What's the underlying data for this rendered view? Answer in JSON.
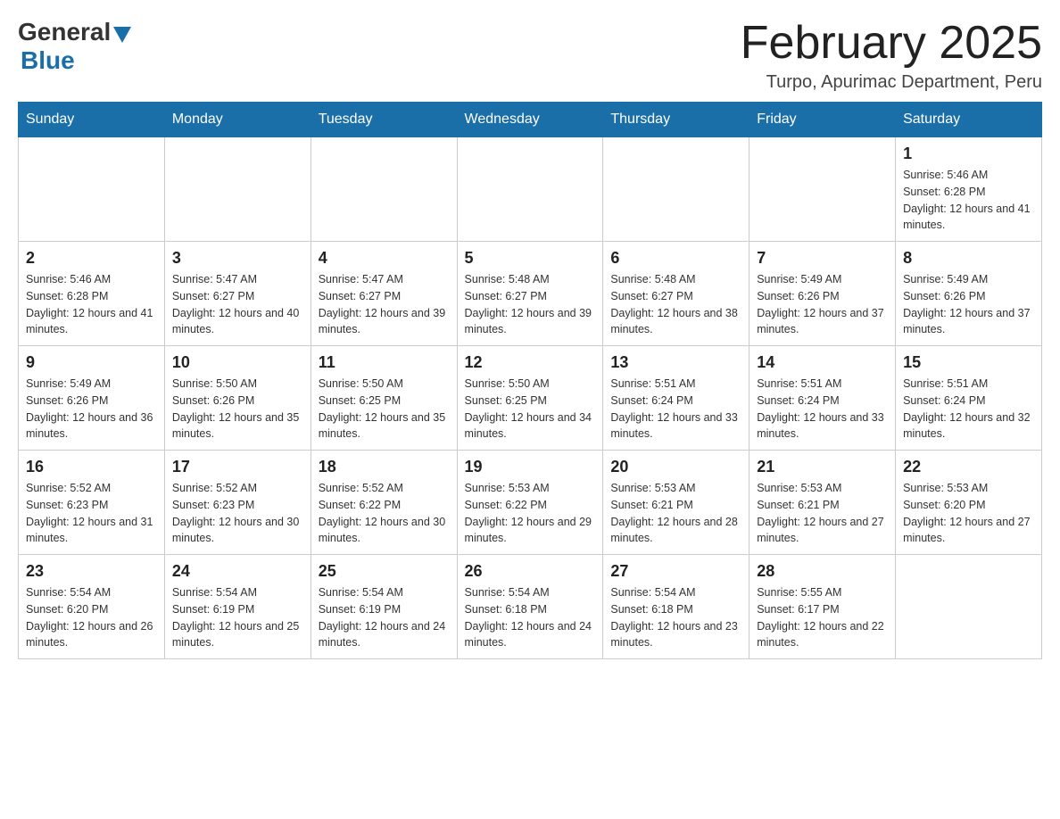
{
  "header": {
    "logo_general": "General",
    "logo_blue": "Blue",
    "month_title": "February 2025",
    "location": "Turpo, Apurimac Department, Peru"
  },
  "weekdays": [
    "Sunday",
    "Monday",
    "Tuesday",
    "Wednesday",
    "Thursday",
    "Friday",
    "Saturday"
  ],
  "weeks": [
    [
      {
        "day": "",
        "info": ""
      },
      {
        "day": "",
        "info": ""
      },
      {
        "day": "",
        "info": ""
      },
      {
        "day": "",
        "info": ""
      },
      {
        "day": "",
        "info": ""
      },
      {
        "day": "",
        "info": ""
      },
      {
        "day": "1",
        "info": "Sunrise: 5:46 AM\nSunset: 6:28 PM\nDaylight: 12 hours and 41 minutes."
      }
    ],
    [
      {
        "day": "2",
        "info": "Sunrise: 5:46 AM\nSunset: 6:28 PM\nDaylight: 12 hours and 41 minutes."
      },
      {
        "day": "3",
        "info": "Sunrise: 5:47 AM\nSunset: 6:27 PM\nDaylight: 12 hours and 40 minutes."
      },
      {
        "day": "4",
        "info": "Sunrise: 5:47 AM\nSunset: 6:27 PM\nDaylight: 12 hours and 39 minutes."
      },
      {
        "day": "5",
        "info": "Sunrise: 5:48 AM\nSunset: 6:27 PM\nDaylight: 12 hours and 39 minutes."
      },
      {
        "day": "6",
        "info": "Sunrise: 5:48 AM\nSunset: 6:27 PM\nDaylight: 12 hours and 38 minutes."
      },
      {
        "day": "7",
        "info": "Sunrise: 5:49 AM\nSunset: 6:26 PM\nDaylight: 12 hours and 37 minutes."
      },
      {
        "day": "8",
        "info": "Sunrise: 5:49 AM\nSunset: 6:26 PM\nDaylight: 12 hours and 37 minutes."
      }
    ],
    [
      {
        "day": "9",
        "info": "Sunrise: 5:49 AM\nSunset: 6:26 PM\nDaylight: 12 hours and 36 minutes."
      },
      {
        "day": "10",
        "info": "Sunrise: 5:50 AM\nSunset: 6:26 PM\nDaylight: 12 hours and 35 minutes."
      },
      {
        "day": "11",
        "info": "Sunrise: 5:50 AM\nSunset: 6:25 PM\nDaylight: 12 hours and 35 minutes."
      },
      {
        "day": "12",
        "info": "Sunrise: 5:50 AM\nSunset: 6:25 PM\nDaylight: 12 hours and 34 minutes."
      },
      {
        "day": "13",
        "info": "Sunrise: 5:51 AM\nSunset: 6:24 PM\nDaylight: 12 hours and 33 minutes."
      },
      {
        "day": "14",
        "info": "Sunrise: 5:51 AM\nSunset: 6:24 PM\nDaylight: 12 hours and 33 minutes."
      },
      {
        "day": "15",
        "info": "Sunrise: 5:51 AM\nSunset: 6:24 PM\nDaylight: 12 hours and 32 minutes."
      }
    ],
    [
      {
        "day": "16",
        "info": "Sunrise: 5:52 AM\nSunset: 6:23 PM\nDaylight: 12 hours and 31 minutes."
      },
      {
        "day": "17",
        "info": "Sunrise: 5:52 AM\nSunset: 6:23 PM\nDaylight: 12 hours and 30 minutes."
      },
      {
        "day": "18",
        "info": "Sunrise: 5:52 AM\nSunset: 6:22 PM\nDaylight: 12 hours and 30 minutes."
      },
      {
        "day": "19",
        "info": "Sunrise: 5:53 AM\nSunset: 6:22 PM\nDaylight: 12 hours and 29 minutes."
      },
      {
        "day": "20",
        "info": "Sunrise: 5:53 AM\nSunset: 6:21 PM\nDaylight: 12 hours and 28 minutes."
      },
      {
        "day": "21",
        "info": "Sunrise: 5:53 AM\nSunset: 6:21 PM\nDaylight: 12 hours and 27 minutes."
      },
      {
        "day": "22",
        "info": "Sunrise: 5:53 AM\nSunset: 6:20 PM\nDaylight: 12 hours and 27 minutes."
      }
    ],
    [
      {
        "day": "23",
        "info": "Sunrise: 5:54 AM\nSunset: 6:20 PM\nDaylight: 12 hours and 26 minutes."
      },
      {
        "day": "24",
        "info": "Sunrise: 5:54 AM\nSunset: 6:19 PM\nDaylight: 12 hours and 25 minutes."
      },
      {
        "day": "25",
        "info": "Sunrise: 5:54 AM\nSunset: 6:19 PM\nDaylight: 12 hours and 24 minutes."
      },
      {
        "day": "26",
        "info": "Sunrise: 5:54 AM\nSunset: 6:18 PM\nDaylight: 12 hours and 24 minutes."
      },
      {
        "day": "27",
        "info": "Sunrise: 5:54 AM\nSunset: 6:18 PM\nDaylight: 12 hours and 23 minutes."
      },
      {
        "day": "28",
        "info": "Sunrise: 5:55 AM\nSunset: 6:17 PM\nDaylight: 12 hours and 22 minutes."
      },
      {
        "day": "",
        "info": ""
      }
    ]
  ]
}
